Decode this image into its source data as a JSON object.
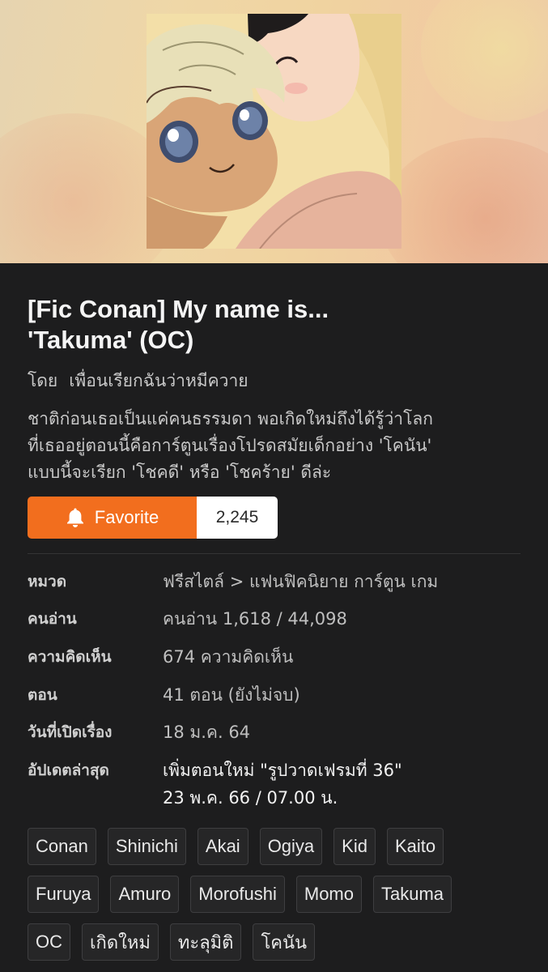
{
  "story": {
    "title_line1": "[Fic Conan] My name is...",
    "title_line2": "'Takuma' (OC)",
    "author_prefix": "โดย",
    "author_name": "เพื่อนเรียกฉันว่าหมีควาย",
    "synopsis": "ชาติก่อนเธอเป็นแค่คนธรรมดา พอเกิดใหม่ถึงได้รู้ว่าโลก\nที่เธออยู่ตอนนี้คือการ์ตูนเรื่องโปรดสมัยเด็กอย่าง 'โคนัน'\nแบบนี้จะเรียก 'โชคดี' หรือ 'โชคร้าย' ดีล่ะ"
  },
  "favorite": {
    "label": "Favorite",
    "count": "2,245",
    "icon": "bell-icon",
    "color": "#f26e1e"
  },
  "info": {
    "category_label": "หมวด",
    "category_value": "ฟรีสไตล์ > แฟนฟิคนิยาย การ์ตูน เกม",
    "readers_label": "คนอ่าน",
    "readers_value": "คนอ่าน 1,618 / 44,098",
    "comments_label": "ความคิดเห็น",
    "comments_value": "674 ความคิดเห็น",
    "chapters_label": "ตอน",
    "chapters_value": "41 ตอน (ยังไม่จบ)",
    "opened_label": "วันที่เปิดเรื่อง",
    "opened_value": "18 ม.ค. 64",
    "updated_label": "อัปเดตล่าสุด",
    "updated_line1": "เพิ่มตอนใหม่ \"รูปวาดเฟรมที่ 36\"",
    "updated_line2": "23 พ.ค. 66 / 07.00 น."
  },
  "tags": [
    [
      "Conan",
      "Shinichi",
      "Akai",
      "Ogiya",
      "Kid",
      "Kaito"
    ],
    [
      "Furuya",
      "Amuro",
      "Morofushi",
      "Momo",
      "Takuma"
    ],
    [
      "OC",
      "เกิดใหม่",
      "ทะลุมิติ",
      "โคนัน"
    ]
  ],
  "colors": {
    "background": "#1d1d1e",
    "accent": "#f26e1e",
    "tag_border": "#3e3e40"
  }
}
